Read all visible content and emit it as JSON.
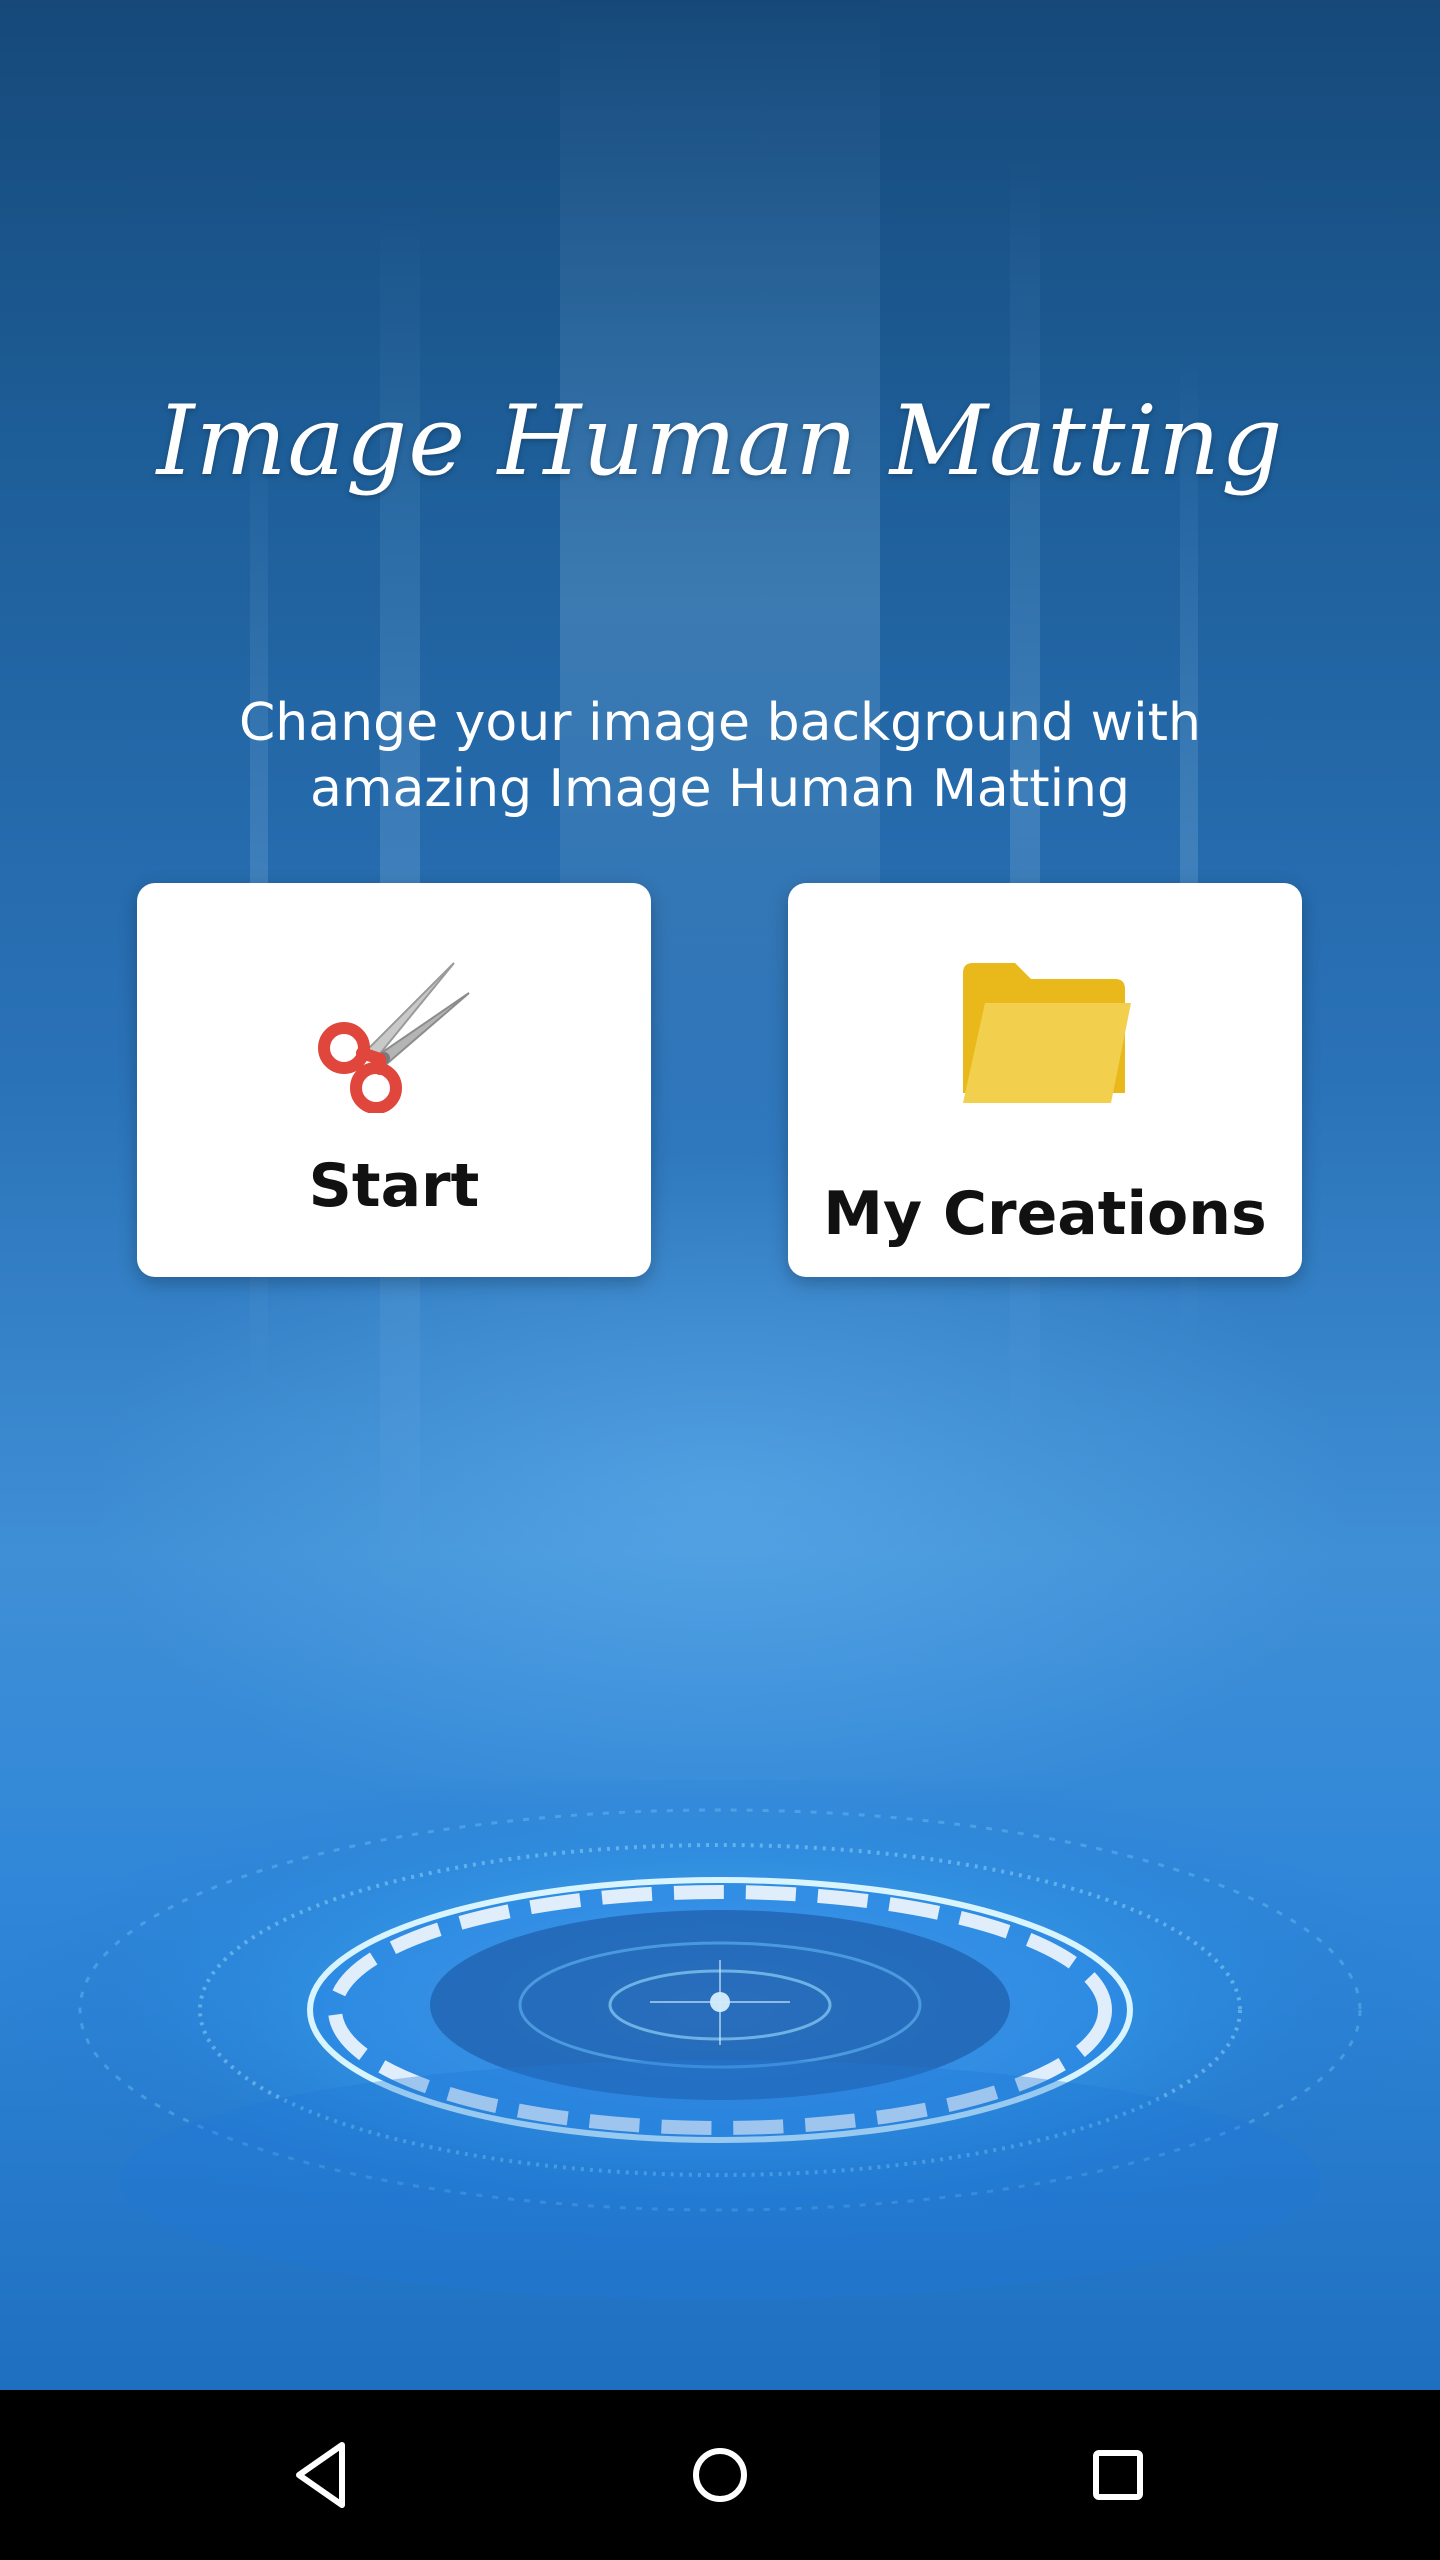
{
  "app": {
    "title": "Image Human Matting",
    "subtitle": "Change your image background with amazing Image Human Matting"
  },
  "actions": {
    "start_label": "Start",
    "start_icon": "scissors-icon",
    "creations_label": "My Creations",
    "creations_icon": "folder-icon"
  },
  "navigation": {
    "back_icon": "back-triangle-icon",
    "home_icon": "home-circle-icon",
    "recents_icon": "recents-square-icon"
  },
  "colors": {
    "background_top": "#16497a",
    "background_bottom": "#3f8fd6",
    "card_background": "#ffffff",
    "folder_yellow": "#f0c419",
    "scissors_red": "#e0463c",
    "nav_bar": "#000000"
  }
}
